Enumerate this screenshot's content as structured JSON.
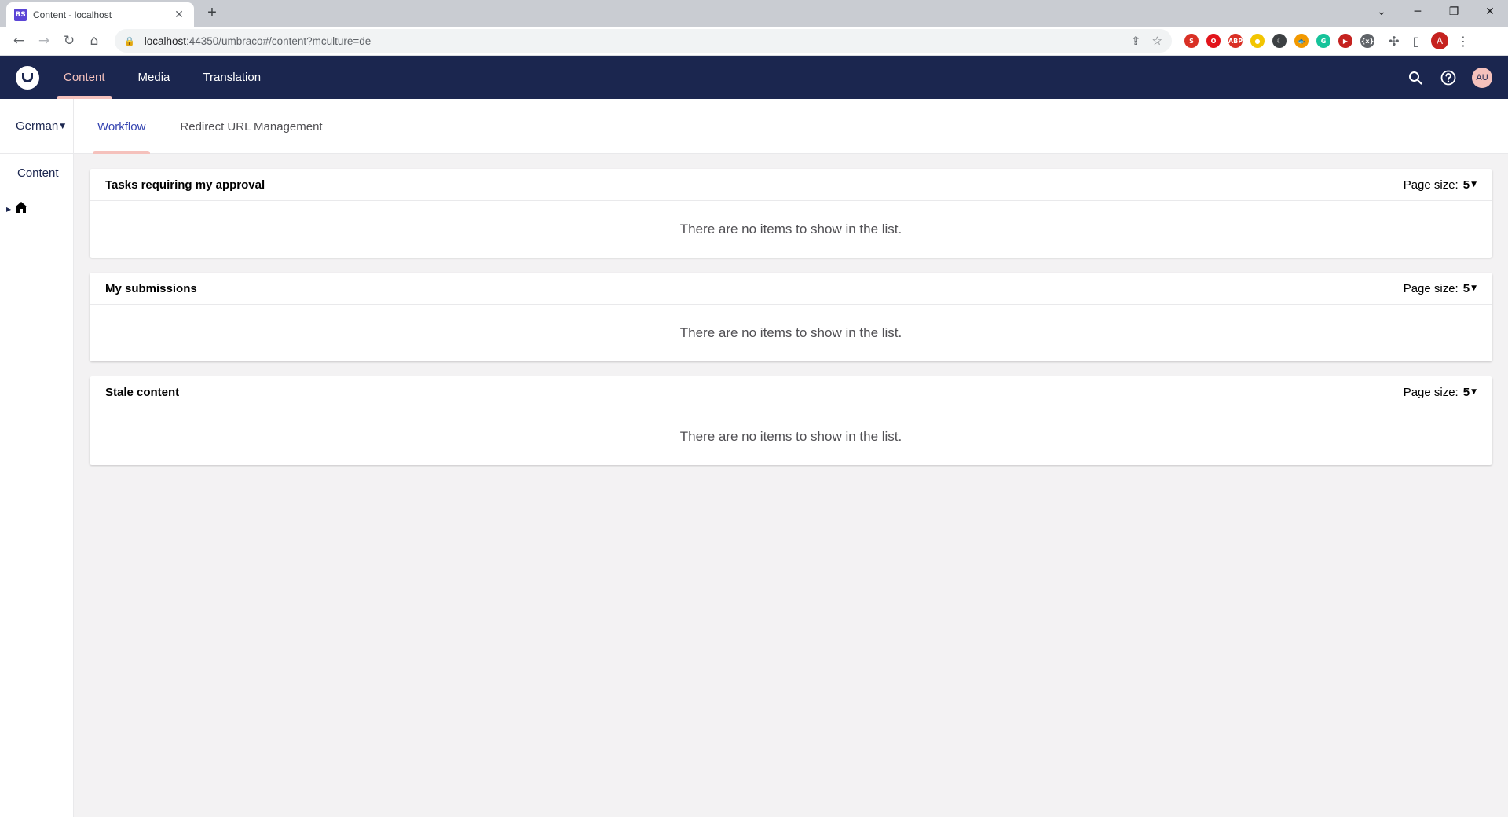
{
  "browser": {
    "tab_title": "Content - localhost",
    "tab_favicon": "BS",
    "new_tab": "+",
    "url_host": "localhost",
    "url_rest": ":44350/umbraco#/content?mculture=de",
    "profile_initial": "A",
    "extensions": [
      {
        "icon": "s-shield-icon",
        "color": "#d93025",
        "glyph": "S"
      },
      {
        "icon": "opera-icon",
        "color": "#e2141b",
        "glyph": "O"
      },
      {
        "icon": "adblock-icon",
        "color": "#d93025",
        "glyph": "ABP"
      },
      {
        "icon": "yellow-circle-icon",
        "color": "#f2c500",
        "glyph": "●"
      },
      {
        "icon": "moon-icon",
        "color": "#3c4043",
        "glyph": "☾"
      },
      {
        "icon": "fish-icon",
        "color": "#f29900",
        "glyph": "🐟"
      },
      {
        "icon": "grammarly-icon",
        "color": "#15c39a",
        "glyph": "G"
      },
      {
        "icon": "play-icon",
        "color": "#c5221f",
        "glyph": "▶"
      },
      {
        "icon": "variable-icon",
        "color": "#5f6368",
        "glyph": "{x}"
      }
    ]
  },
  "header": {
    "sections": [
      {
        "label": "Content",
        "active": true
      },
      {
        "label": "Media",
        "active": false
      },
      {
        "label": "Translation",
        "active": false
      }
    ],
    "avatar_initials": "AU"
  },
  "tree": {
    "culture": "German",
    "title": "Content"
  },
  "subtabs": [
    {
      "label": "Workflow",
      "active": true
    },
    {
      "label": "Redirect URL Management",
      "active": false
    }
  ],
  "panels": [
    {
      "title": "Tasks requiring my approval",
      "page_size_label": "Page size:",
      "page_size": "5",
      "empty_text": "There are no items to show in the list."
    },
    {
      "title": "My submissions",
      "page_size_label": "Page size:",
      "page_size": "5",
      "empty_text": "There are no items to show in the list."
    },
    {
      "title": "Stale content",
      "page_size_label": "Page size:",
      "page_size": "5",
      "empty_text": "There are no items to show in the list."
    }
  ],
  "colors": {
    "header_bg": "#1b264f",
    "accent_pink": "#f5c1bc",
    "active_tab_text": "#3544b1",
    "page_bg": "#f3f2f3"
  }
}
